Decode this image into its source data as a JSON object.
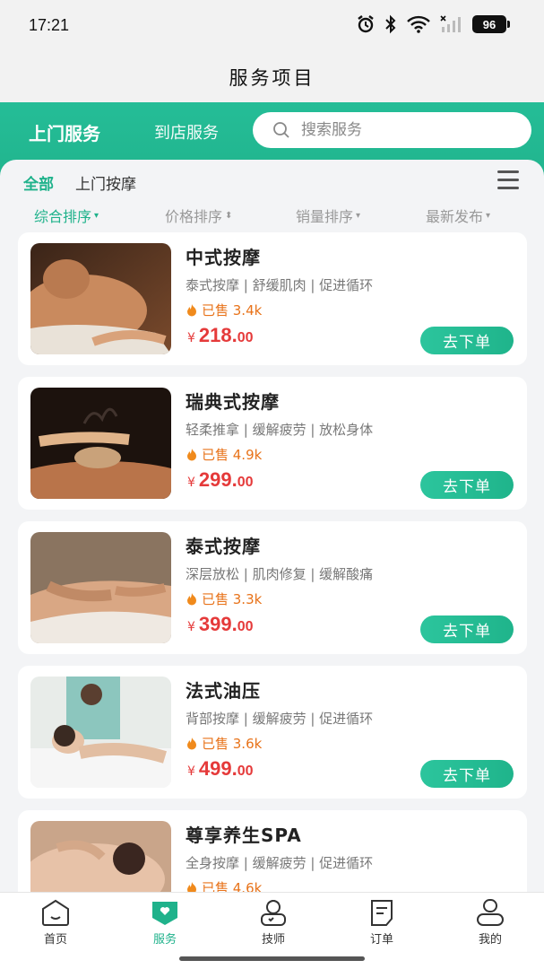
{
  "status_bar": {
    "time": "17:21",
    "battery": "96"
  },
  "header": {
    "title": "服务项目"
  },
  "tabs": [
    {
      "label": "上门服务",
      "active": true
    },
    {
      "label": "到店服务",
      "active": false
    }
  ],
  "search": {
    "placeholder": "搜索服务",
    "value": ""
  },
  "categories": [
    {
      "label": "全部",
      "active": true
    },
    {
      "label": "上门按摩",
      "active": false
    }
  ],
  "sort": [
    {
      "label": "综合排序",
      "caret": "▾",
      "active": true
    },
    {
      "label": "价格排序",
      "caret": "⬍",
      "active": false
    },
    {
      "label": "销量排序",
      "caret": "▾",
      "active": false
    },
    {
      "label": "最新发布",
      "caret": "▾",
      "active": false
    }
  ],
  "products": [
    {
      "title": "中式按摩",
      "tags": "泰式按摩 | 舒缓肌肉 | 促进循环",
      "sold": "已售 3.4k",
      "currency": "¥",
      "price_int": "218.",
      "price_dec": "00",
      "button": "去下单"
    },
    {
      "title": "瑞典式按摩",
      "tags": "轻柔推拿 | 缓解疲劳 | 放松身体",
      "sold": "已售 4.9k",
      "currency": "¥",
      "price_int": "299.",
      "price_dec": "00",
      "button": "去下单"
    },
    {
      "title": "泰式按摩",
      "tags": "深层放松 | 肌肉修复 | 缓解酸痛",
      "sold": "已售 3.3k",
      "currency": "¥",
      "price_int": "399.",
      "price_dec": "00",
      "button": "去下单"
    },
    {
      "title": "法式油压",
      "tags": "背部按摩 | 缓解疲劳 | 促进循环",
      "sold": "已售 3.6k",
      "currency": "¥",
      "price_int": "499.",
      "price_dec": "00",
      "button": "去下单"
    },
    {
      "title": "尊享养生SPA",
      "tags": "全身按摩 | 缓解疲劳 | 促进循环",
      "sold": "已售 4.6k",
      "currency": "¥",
      "price_int": "",
      "price_dec": "",
      "button": ""
    }
  ],
  "bottom_nav": [
    {
      "label": "首页",
      "icon": "home-icon",
      "active": false
    },
    {
      "label": "服务",
      "icon": "service-icon",
      "active": true
    },
    {
      "label": "技师",
      "icon": "technician-icon",
      "active": false
    },
    {
      "label": "订单",
      "icon": "order-icon",
      "active": false
    },
    {
      "label": "我的",
      "icon": "profile-icon",
      "active": false
    }
  ],
  "colors": {
    "accent": "#1fb28b",
    "price": "#e53a3a",
    "sold": "#e8731a"
  }
}
